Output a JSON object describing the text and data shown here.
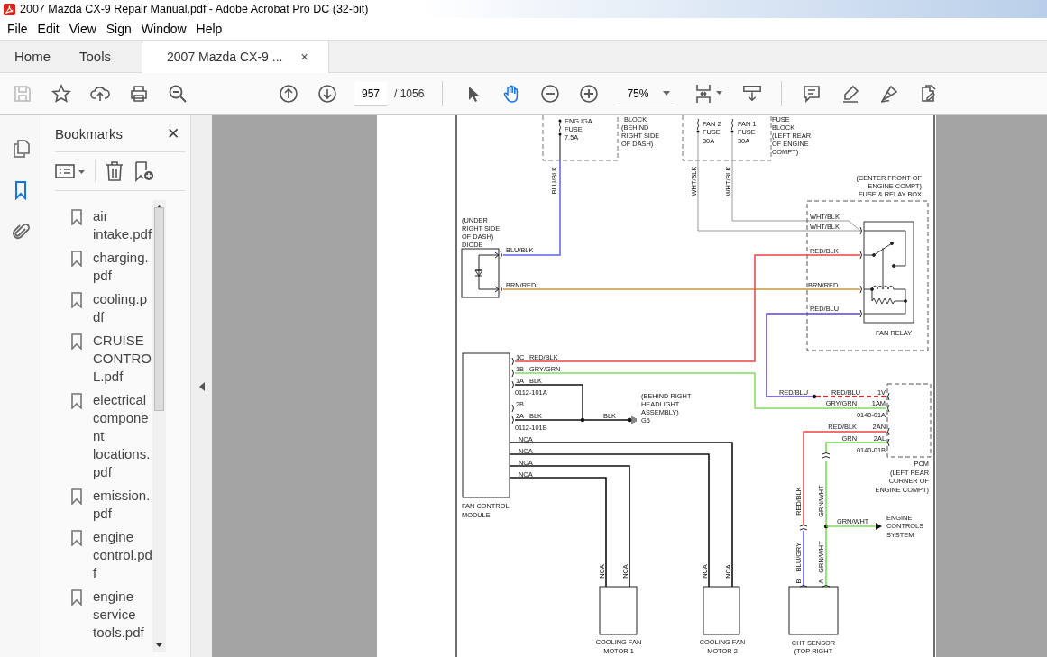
{
  "window": {
    "title": "2007 Mazda CX-9 Repair Manual.pdf - Adobe Acrobat Pro DC (32-bit)"
  },
  "menu": [
    "File",
    "Edit",
    "View",
    "Sign",
    "Window",
    "Help"
  ],
  "tabs": [
    {
      "label": "Home",
      "selected": false
    },
    {
      "label": "Tools",
      "selected": false
    },
    {
      "label": "2007 Mazda CX-9 ...",
      "selected": true,
      "close": "×"
    }
  ],
  "toolbar": {
    "page": "957",
    "page_count": "/ 1056",
    "zoom": "75%"
  },
  "rail": [
    {
      "kind": "pages",
      "selected": false
    },
    {
      "kind": "bookmarks",
      "selected": true
    },
    {
      "kind": "attachments",
      "selected": false
    }
  ],
  "bookmarks": {
    "title": "Bookmarks",
    "close": "✕",
    "items": [
      "air intake.pdf",
      "charging.pdf",
      "cooling.pdf",
      "CRUISE CONTROL.pdf",
      "electrical component locations.pdf",
      "emission.pdf",
      "engine control.pdf",
      "engine service tools.pdf"
    ]
  },
  "diagram": {
    "labels": [
      "ENG IGA",
      "BLOCK",
      "FAN 2",
      "FAN 1",
      "FUSE",
      "FUSE",
      "(BEHIND",
      "FUSE",
      "FUSE",
      "BLOCK",
      "7.5A",
      "RIGHT SIDE",
      "30A",
      "30A",
      "(LEFT REAR",
      "OF DASH)",
      "OF ENGINE",
      "COMPT)",
      "BLU/BLK",
      "WHT/BLK",
      "WHT/BLK",
      "(CENTER FRONT OF",
      "ENGINE COMPT)",
      "FUSE & RELAY BOX",
      "(UNDER",
      "WHT/BLK",
      "RIGHT SIDE",
      "WHT/BLK",
      "OF DASH)",
      "DIODE",
      "BLU/BLK",
      "RED/BLK",
      "BRN/RED",
      "BRN/RED",
      "RED/BLU",
      "FAN RELAY",
      "1C",
      "RED/BLK",
      "1B",
      "GRY/GRN",
      "1A",
      "BLK",
      "0112-101A",
      "(BEHIND RIGHT",
      "RED/BLU",
      "RED/BLU",
      "1V",
      "2B",
      "HEADLIGHT",
      "GRY/GRN",
      "1AM",
      "2A",
      "BLK",
      "BLK",
      "ASSEMBLY)",
      "G5",
      "0140-01A",
      "0112-101B",
      "RED/BLK",
      "2AN",
      "NCA",
      "GRN",
      "2AL",
      "NCA",
      "0140-01B",
      "NCA",
      "PCM",
      "NCA",
      "(LEFT REAR",
      "CORNER OF",
      "ENGINE COMPT)",
      "FAN CONTROL",
      "MODULE",
      "RED/BLK",
      "GRN/WHT",
      "GRN/WHT",
      "ENGINE",
      "CONTROLS",
      "SYSTEM",
      "NCA",
      "NCA",
      "NCA",
      "NCA",
      "B",
      "BLU/GRY",
      "A",
      "GRN/WHT",
      "COOLING FAN",
      "MOTOR 1",
      "COOLING FAN",
      "MOTOR 2",
      "CHT SENSOR",
      "(TOP RIGHT"
    ]
  }
}
